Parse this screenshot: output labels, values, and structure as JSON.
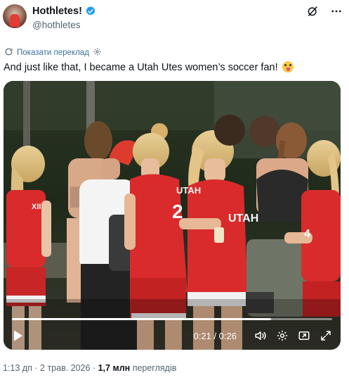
{
  "author": {
    "display_name": "Hothletes!",
    "handle": "@hothletes",
    "verified": true
  },
  "translate_label": "Показати переклад",
  "tweet_text": "And just like that, I became a Utah Utes women’s soccer fan!",
  "video": {
    "current_time": "0:21",
    "duration": "0:26",
    "progress": 0.81,
    "jersey_text": [
      "UTAH",
      "2",
      "UTAH",
      "4",
      "XII"
    ]
  },
  "meta": {
    "time": "1:13 дп",
    "separator": "·",
    "date": "2 трав. 2026",
    "views_count": "1,7 млн",
    "views_label": "переглядів"
  },
  "colors": {
    "accent": "#1d9bf0",
    "jersey_red": "#d92b2b",
    "text_secondary": "#536471"
  }
}
